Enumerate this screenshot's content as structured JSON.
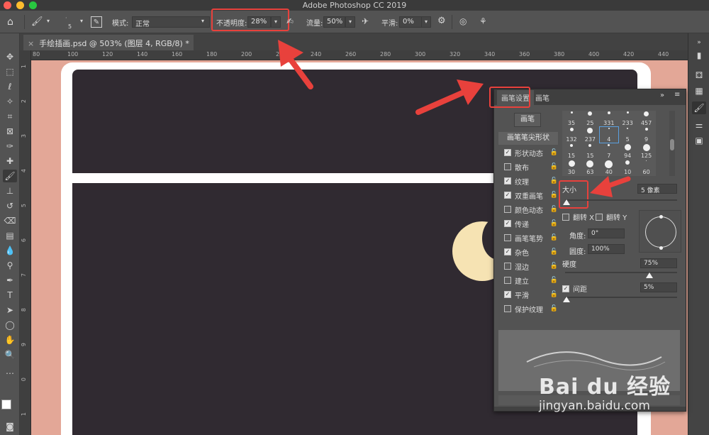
{
  "window": {
    "title": "Adobe Photoshop CC 2019"
  },
  "options_bar": {
    "brush_size": "5",
    "mode_label": "模式:",
    "mode_value": "正常",
    "opacity_label": "不透明度:",
    "opacity_value": "28%",
    "flow_label": "流量:",
    "flow_value": "50%",
    "smooth_label": "平滑:",
    "smooth_value": "0%"
  },
  "document_tab": {
    "title": "手绘插画.psd @ 503% (图层 4, RGB/8) *"
  },
  "ruler_h_labels": [
    "80",
    "100",
    "120",
    "140",
    "160",
    "180",
    "200",
    "220",
    "240",
    "260",
    "280",
    "300",
    "320",
    "340",
    "360",
    "380",
    "400",
    "420",
    "440"
  ],
  "ruler_v_labels": [
    "1",
    "2",
    "3",
    "4",
    "5",
    "6",
    "7",
    "8",
    "9",
    "0",
    "1"
  ],
  "brush_panel": {
    "tab_settings": "画笔设置",
    "tab_brushes": "画笔",
    "brushes_button": "画笔",
    "tip_shape_title": "画笔笔尖形状",
    "options": [
      {
        "label": "形状动态",
        "checked": true
      },
      {
        "label": "散布",
        "checked": false
      },
      {
        "label": "纹理",
        "checked": true
      },
      {
        "label": "双重画笔",
        "checked": true
      },
      {
        "label": "颜色动态",
        "checked": false
      },
      {
        "label": "传递",
        "checked": true
      },
      {
        "label": "画笔笔势",
        "checked": false
      },
      {
        "label": "杂色",
        "checked": true
      },
      {
        "label": "湿边",
        "checked": false
      },
      {
        "label": "建立",
        "checked": false
      },
      {
        "label": "平滑",
        "checked": true
      },
      {
        "label": "保护纹理",
        "checked": false
      }
    ],
    "presets": [
      "35",
      "25",
      "331",
      "233",
      "457",
      "132",
      "237",
      "4",
      "5",
      "9",
      "15",
      "15",
      "7",
      "94",
      "125",
      "30",
      "63",
      "40",
      "10",
      "60"
    ],
    "size_label": "大小",
    "size_value": "5 像素",
    "flip_x_label": "翻转 X",
    "flip_y_label": "翻转 Y",
    "angle_label": "角度:",
    "angle_value": "0°",
    "roundness_label": "圆度:",
    "roundness_value": "100%",
    "hardness_label": "硬度",
    "hardness_value": "75%",
    "spacing_label": "间距",
    "spacing_value": "5%",
    "spacing_checked": true,
    "hardness_level": 0.75
  },
  "watermark": {
    "main": "Bai du 经验",
    "url": "jingyan.baidu.com"
  },
  "colors": {
    "accent_red": "#e8413c",
    "peach": "#e3a797",
    "dark_canvas": "#302a31",
    "moon": "#f6e3b3"
  }
}
